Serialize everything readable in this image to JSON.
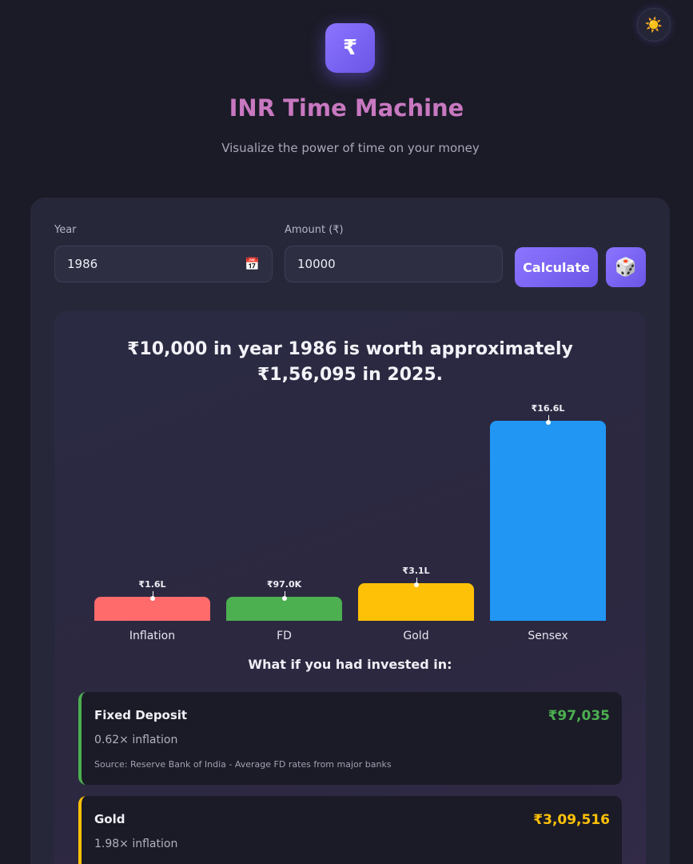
{
  "header": {
    "logo_symbol": "₹",
    "title": "INR Time Machine",
    "subtitle": "Visualize the power of time on your money",
    "theme_icon": "sun-icon"
  },
  "form": {
    "year_label": "Year",
    "year_value": "1986",
    "amount_label": "Amount (₹)",
    "amount_value": "10000",
    "calculate_label": "Calculate",
    "random_icon": "dice-icon"
  },
  "result": {
    "line1": "₹10,000 in year 1986 is worth approximately",
    "line2": "₹1,56,095 in 2025."
  },
  "chart_data": {
    "type": "bar",
    "categories": [
      "Inflation",
      "FD",
      "Gold",
      "Sensex"
    ],
    "values": [
      156095,
      97035,
      309516,
      1660000
    ],
    "data_labels": [
      "₹1.6L",
      "₹97.0K",
      "₹3.1L",
      "₹16.6L"
    ],
    "colors": [
      "#ff6b6b",
      "#4caf50",
      "#ffc107",
      "#2196f3"
    ],
    "title": "",
    "xlabel": "",
    "ylabel": "",
    "grid": false
  },
  "investments": {
    "title": "What if you had invested in:",
    "items": [
      {
        "name": "Fixed Deposit",
        "value": "₹97,035",
        "ratio": "0.62× inflation",
        "source": "Source: Reserve Bank of India - Average FD rates from major banks",
        "color": "#4caf50"
      },
      {
        "name": "Gold",
        "value": "₹3,09,516",
        "ratio": "1.98× inflation",
        "source": "",
        "color": "#ffc107"
      }
    ]
  }
}
